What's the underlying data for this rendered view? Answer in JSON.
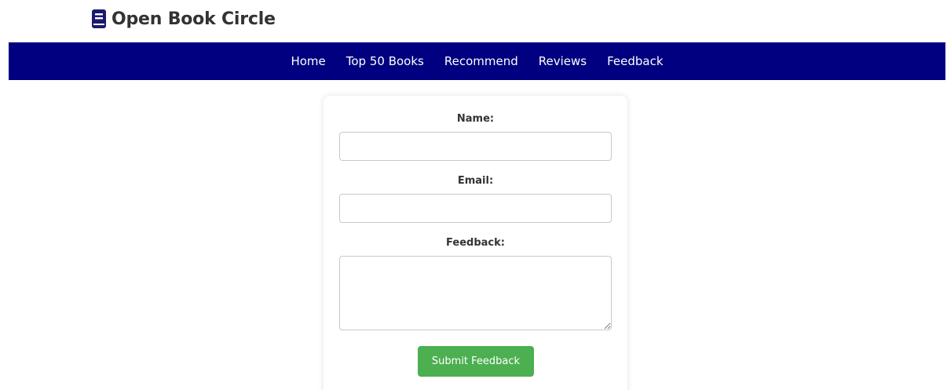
{
  "header": {
    "title": "Open Book Circle",
    "logo_icon": "book-icon",
    "brand_color": "#1a1a6e"
  },
  "nav": {
    "background": "#000080",
    "items": [
      {
        "label": "Home"
      },
      {
        "label": "Top 50 Books"
      },
      {
        "label": "Recommend"
      },
      {
        "label": "Reviews"
      },
      {
        "label": "Feedback"
      }
    ]
  },
  "form": {
    "name_label": "Name:",
    "name_value": "",
    "email_label": "Email:",
    "email_value": "",
    "feedback_label": "Feedback:",
    "feedback_value": "",
    "submit_label": "Submit Feedback",
    "submit_color": "#4caf50"
  }
}
